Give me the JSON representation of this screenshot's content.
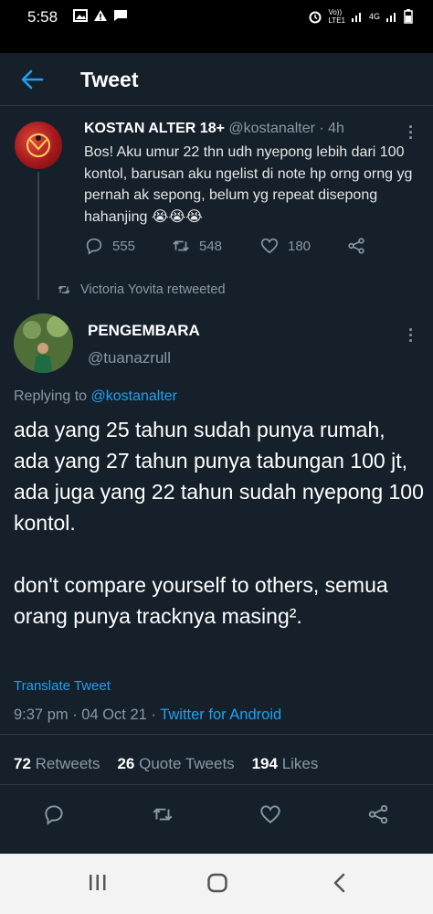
{
  "status_bar": {
    "time": "5:58",
    "network_label": "Vo))\nLTE1",
    "net_type": "4G"
  },
  "app_bar": {
    "title": "Tweet"
  },
  "tweet1": {
    "name": "KOSTAN ALTER 18+",
    "handle": "@kostanalter",
    "time": "4h",
    "body": "Bos! Aku umur 22 thn udh nyepong lebih dari 100 kontol, barusan aku ngelist di note hp orng orng yg pernah ak sepong, belum yg repeat disepong hahanjing 😭😭😭",
    "replies": "555",
    "retweets": "548",
    "likes": "180"
  },
  "retweet_context": "Victoria Yovita retweeted",
  "tweet2": {
    "name": "PENGEMBARA",
    "handle": "@tuanazrull",
    "replying_prefix": "Replying to ",
    "replying_to": "@kostanalter",
    "body_p1": "ada yang 25 tahun sudah punya rumah, ada yang 27 tahun punya tabungan 100 jt, ada juga yang 22 tahun sudah nyepong 100 kontol.",
    "body_p2": "don't compare yourself to others, semua orang punya tracknya masing².",
    "translate": "Translate Tweet",
    "timestamp": "9:37 pm · 04 Oct 21 · ",
    "source": "Twitter for Android",
    "retweets_count": "72",
    "retweets_label": "Retweets",
    "quote_count": "26",
    "quote_label": "Quote Tweets",
    "likes_count": "194",
    "likes_label": "Likes"
  },
  "icons": {
    "back": "arrow-left-icon",
    "reply": "comment-icon",
    "retweet": "retweet-icon",
    "like": "heart-icon",
    "share": "share-icon"
  },
  "colors": {
    "background": "#15202b",
    "accent": "#1da1f2",
    "secondary_text": "#8899a6"
  }
}
